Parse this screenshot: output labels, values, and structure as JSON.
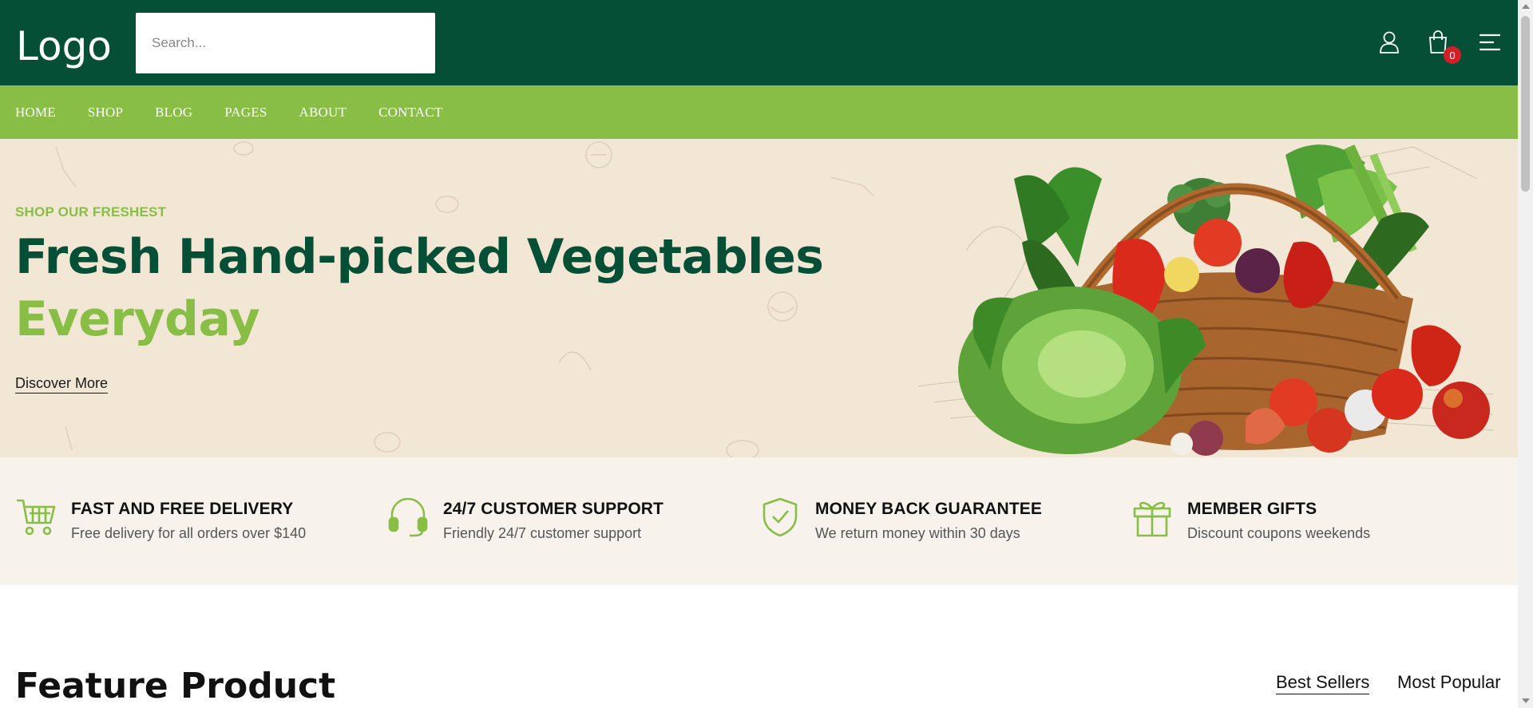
{
  "header": {
    "logo": "Logo",
    "search_placeholder": "Search...",
    "cart_count": "0",
    "icons": [
      "user-icon",
      "shopping-bag-icon",
      "menu-icon"
    ]
  },
  "nav": {
    "items": [
      "HOME",
      "SHOP",
      "BLOG",
      "PAGES",
      "ABOUT",
      "CONTACT"
    ]
  },
  "hero": {
    "eyebrow": "SHOP OUR FRESHEST",
    "headline_line1": "Fresh Hand-picked Vegetables",
    "headline_line2": "Everyday",
    "cta": "Discover More"
  },
  "features": [
    {
      "icon": "cart-icon",
      "title": "FAST AND FREE DELIVERY",
      "desc": "Free delivery for all orders over $140"
    },
    {
      "icon": "headset-icon",
      "title": "24/7 CUSTOMER SUPPORT",
      "desc": "Friendly 24/7 customer support"
    },
    {
      "icon": "shield-check-icon",
      "title": "MONEY BACK GUARANTEE",
      "desc": "We return money within 30 days"
    },
    {
      "icon": "gift-icon",
      "title": "MEMBER GIFTS",
      "desc": "Discount coupons weekends"
    }
  ],
  "feature_product": {
    "title": "Feature Product",
    "tabs": [
      "Best Sellers",
      "Most Popular"
    ],
    "active_tab": "Best Sellers"
  },
  "colors": {
    "header_bg": "#054f36",
    "nav_bg": "#88be45",
    "hero_bg": "#f2e6d5",
    "features_bg": "#f7f3ec",
    "accent_green": "#88be45",
    "dark_green": "#054f36",
    "badge_red": "#d32027"
  }
}
